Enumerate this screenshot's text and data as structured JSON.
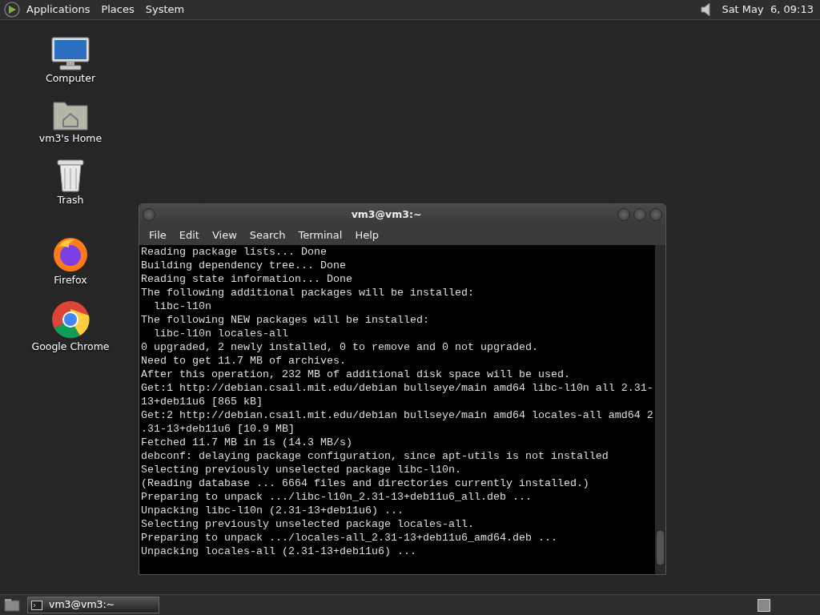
{
  "top_panel": {
    "menus": [
      "Applications",
      "Places",
      "System"
    ],
    "clock": "Sat May  6, 09:13"
  },
  "desktop_icons": [
    {
      "kind": "computer",
      "label": "Computer"
    },
    {
      "kind": "home",
      "label": "vm3's Home"
    },
    {
      "kind": "trash",
      "label": "Trash"
    },
    {
      "kind": "firefox",
      "label": "Firefox"
    },
    {
      "kind": "chrome",
      "label": "Google Chrome"
    }
  ],
  "terminal": {
    "title": "vm3@vm3:~",
    "menus": [
      "File",
      "Edit",
      "View",
      "Search",
      "Terminal",
      "Help"
    ],
    "lines": [
      "Reading package lists... Done",
      "Building dependency tree... Done",
      "Reading state information... Done",
      "The following additional packages will be installed:",
      "  libc-l10n",
      "The following NEW packages will be installed:",
      "  libc-l10n locales-all",
      "0 upgraded, 2 newly installed, 0 to remove and 0 not upgraded.",
      "Need to get 11.7 MB of archives.",
      "After this operation, 232 MB of additional disk space will be used.",
      "Get:1 http://debian.csail.mit.edu/debian bullseye/main amd64 libc-l10n all 2.31-",
      "13+deb11u6 [865 kB]",
      "Get:2 http://debian.csail.mit.edu/debian bullseye/main amd64 locales-all amd64 2",
      ".31-13+deb11u6 [10.9 MB]",
      "Fetched 11.7 MB in 1s (14.3 MB/s)",
      "debconf: delaying package configuration, since apt-utils is not installed",
      "Selecting previously unselected package libc-l10n.",
      "(Reading database ... 6664 files and directories currently installed.)",
      "Preparing to unpack .../libc-l10n_2.31-13+deb11u6_all.deb ...",
      "Unpacking libc-l10n (2.31-13+deb11u6) ...",
      "Selecting previously unselected package locales-all.",
      "Preparing to unpack .../locales-all_2.31-13+deb11u6_amd64.deb ...",
      "Unpacking locales-all (2.31-13+deb11u6) ..."
    ]
  },
  "taskbar": {
    "tasks": [
      {
        "label": "vm3@vm3:~",
        "selected": true
      }
    ]
  }
}
